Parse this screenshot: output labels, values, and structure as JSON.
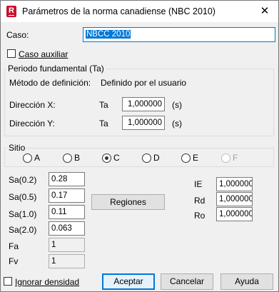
{
  "window": {
    "title": "Parámetros de la norma canadiense (NBC 2010)",
    "close_glyph": "✕",
    "app_icon_letter": "R"
  },
  "caso": {
    "label": "Caso:",
    "value": "NBCC 2010"
  },
  "caso_auxiliar": {
    "label": "Caso auxiliar",
    "checked": false
  },
  "periodo": {
    "title": "Periodo fundamental (Ta)",
    "method_label": "Método de definición:",
    "method_value": "Definido por el usuario",
    "dir_x": {
      "label": "Dirección X:",
      "sym": "Ta",
      "value": "1,000000",
      "unit": "(s)"
    },
    "dir_y": {
      "label": "Dirección Y:",
      "sym": "Ta",
      "value": "1,000000",
      "unit": "(s)"
    }
  },
  "sitio": {
    "title": "Sitio",
    "options": [
      {
        "label": "A",
        "checked": false,
        "enabled": true
      },
      {
        "label": "B",
        "checked": false,
        "enabled": true
      },
      {
        "label": "C",
        "checked": true,
        "enabled": true
      },
      {
        "label": "D",
        "checked": false,
        "enabled": true
      },
      {
        "label": "E",
        "checked": false,
        "enabled": true
      },
      {
        "label": "F",
        "checked": false,
        "enabled": false
      }
    ]
  },
  "sa": {
    "sa02": {
      "label": "Sa(0.2)",
      "value": "0.28"
    },
    "sa05": {
      "label": "Sa(0.5)",
      "value": "0.17"
    },
    "sa10": {
      "label": "Sa(1.0)",
      "value": "0.11"
    },
    "sa20": {
      "label": "Sa(2.0)",
      "value": "0.063"
    },
    "fa": {
      "label": "Fa",
      "value": "1"
    },
    "fv": {
      "label": "Fv",
      "value": "1"
    }
  },
  "regiones_button": "Regiones",
  "factors": {
    "ie": {
      "label": "IE",
      "value": "1,000000"
    },
    "rd": {
      "label": "Rd",
      "value": "1,000000"
    },
    "ro": {
      "label": "Ro",
      "value": "1,000000"
    }
  },
  "ignorar_densidad": {
    "label": "Ignorar densidad",
    "checked": false
  },
  "buttons": {
    "accept": "Aceptar",
    "cancel": "Cancelar",
    "help": "Ayuda"
  },
  "colors": {
    "accent": "#0078d7",
    "icon_red": "#c8102e",
    "background": "#f0f0f0"
  }
}
